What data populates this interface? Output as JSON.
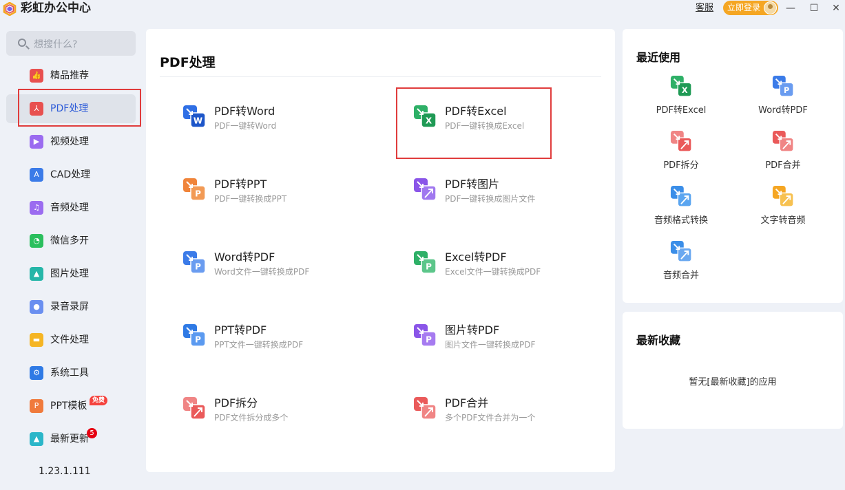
{
  "window": {
    "title": "彩虹办公中心",
    "service_link": "客服",
    "login_button": "立即登录"
  },
  "search": {
    "placeholder": "想搜什么?"
  },
  "sidebar": {
    "items": [
      {
        "label": "精品推荐",
        "icon": "thumbs-up-icon",
        "color": "#e8504f"
      },
      {
        "label": "PDF处理",
        "icon": "pdf-icon",
        "color": "#e8504f",
        "active": true
      },
      {
        "label": "视频处理",
        "icon": "video-play-icon",
        "color": "#9b6cf0"
      },
      {
        "label": "CAD处理",
        "icon": "cad-icon",
        "color": "#3b7be8"
      },
      {
        "label": "音频处理",
        "icon": "music-note-icon",
        "color": "#9b6cf0"
      },
      {
        "label": "微信多开",
        "icon": "wechat-icon",
        "color": "#2bbf5e"
      },
      {
        "label": "图片处理",
        "icon": "image-icon",
        "color": "#25b6a8"
      },
      {
        "label": "录音录屏",
        "icon": "microphone-icon",
        "color": "#6a8ff0"
      },
      {
        "label": "文件处理",
        "icon": "folder-icon",
        "color": "#f5b524"
      },
      {
        "label": "系统工具",
        "icon": "gear-icon",
        "color": "#2f7ae5"
      },
      {
        "label": "PPT模板",
        "icon": "ppt-icon",
        "color": "#f07a3c",
        "badge": "免费"
      },
      {
        "label": "最新更新",
        "icon": "upload-icon",
        "color": "#2bb6c9",
        "count": "5"
      }
    ],
    "version": "1.23.1.111"
  },
  "main": {
    "title": "PDF处理",
    "tools": [
      {
        "name": "PDF转Word",
        "desc": "PDF一键转Word",
        "icon": "pdf-to-word-icon",
        "c1": "#2f6fe5",
        "c2": "#1d56c9",
        "letter": "W"
      },
      {
        "name": "PDF转Excel",
        "desc": "PDF一键转换成Excel",
        "icon": "pdf-to-excel-icon",
        "c1": "#2eb067",
        "c2": "#1f9a55",
        "letter": "X"
      },
      {
        "name": "PDF转PPT",
        "desc": "PDF一键转换成PPT",
        "icon": "pdf-to-ppt-icon",
        "c1": "#f0843a",
        "c2": "#f29a55",
        "letter": "P"
      },
      {
        "name": "PDF转图片",
        "desc": "PDF一键转换成图片文件",
        "icon": "pdf-to-image-icon",
        "c1": "#8a55e8",
        "c2": "#a078ef",
        "letter": ""
      },
      {
        "name": "Word转PDF",
        "desc": "Word文件一键转换成PDF",
        "icon": "word-to-pdf-icon",
        "c1": "#3b7be8",
        "c2": "#6a9cf0",
        "letter": "P"
      },
      {
        "name": "Excel转PDF",
        "desc": "Excel文件一键转换成PDF",
        "icon": "excel-to-pdf-icon",
        "c1": "#2eb067",
        "c2": "#5cc68a",
        "letter": "P"
      },
      {
        "name": "PPT转PDF",
        "desc": "PPT文件一键转换成PDF",
        "icon": "ppt-to-pdf-icon",
        "c1": "#2f7ae5",
        "c2": "#5b9af0",
        "letter": "P"
      },
      {
        "name": "图片转PDF",
        "desc": "图片文件一键转换成PDF",
        "icon": "image-to-pdf-icon",
        "c1": "#8a55e8",
        "c2": "#a67bf0",
        "letter": "P"
      },
      {
        "name": "PDF拆分",
        "desc": "PDF文件拆分成多个",
        "icon": "pdf-split-icon",
        "c1": "#f08585",
        "c2": "#ea5a5a",
        "letter": ""
      },
      {
        "name": "PDF合并",
        "desc": "多个PDF文件合并为一个",
        "icon": "pdf-merge-icon",
        "c1": "#ea5a5a",
        "c2": "#f08585",
        "letter": ""
      }
    ]
  },
  "recent": {
    "title": "最近使用",
    "items": [
      {
        "label": "PDF转Excel",
        "icon": "pdf-to-excel-icon",
        "c1": "#2eb067",
        "c2": "#1f9a55",
        "letter": "X"
      },
      {
        "label": "Word转PDF",
        "icon": "word-to-pdf-icon",
        "c1": "#3b7be8",
        "c2": "#6a9cf0",
        "letter": "P"
      },
      {
        "label": "PDF拆分",
        "icon": "pdf-split-icon",
        "c1": "#f08585",
        "c2": "#ea5a5a",
        "letter": ""
      },
      {
        "label": "PDF合并",
        "icon": "pdf-merge-icon",
        "c1": "#ea5a5a",
        "c2": "#f08585",
        "letter": ""
      },
      {
        "label": "音频格式转换",
        "icon": "audio-convert-icon",
        "c1": "#3b8ee8",
        "c2": "#5aa5f0",
        "letter": ""
      },
      {
        "label": "文字转音频",
        "icon": "text-to-audio-icon",
        "c1": "#f5a623",
        "c2": "#f7c150",
        "letter": ""
      },
      {
        "label": "音频合并",
        "icon": "audio-merge-icon",
        "c1": "#3b8ee8",
        "c2": "#6aa8f0",
        "letter": ""
      }
    ]
  },
  "favorites": {
    "title": "最新收藏",
    "empty_text": "暂无[最新收藏]的应用"
  }
}
